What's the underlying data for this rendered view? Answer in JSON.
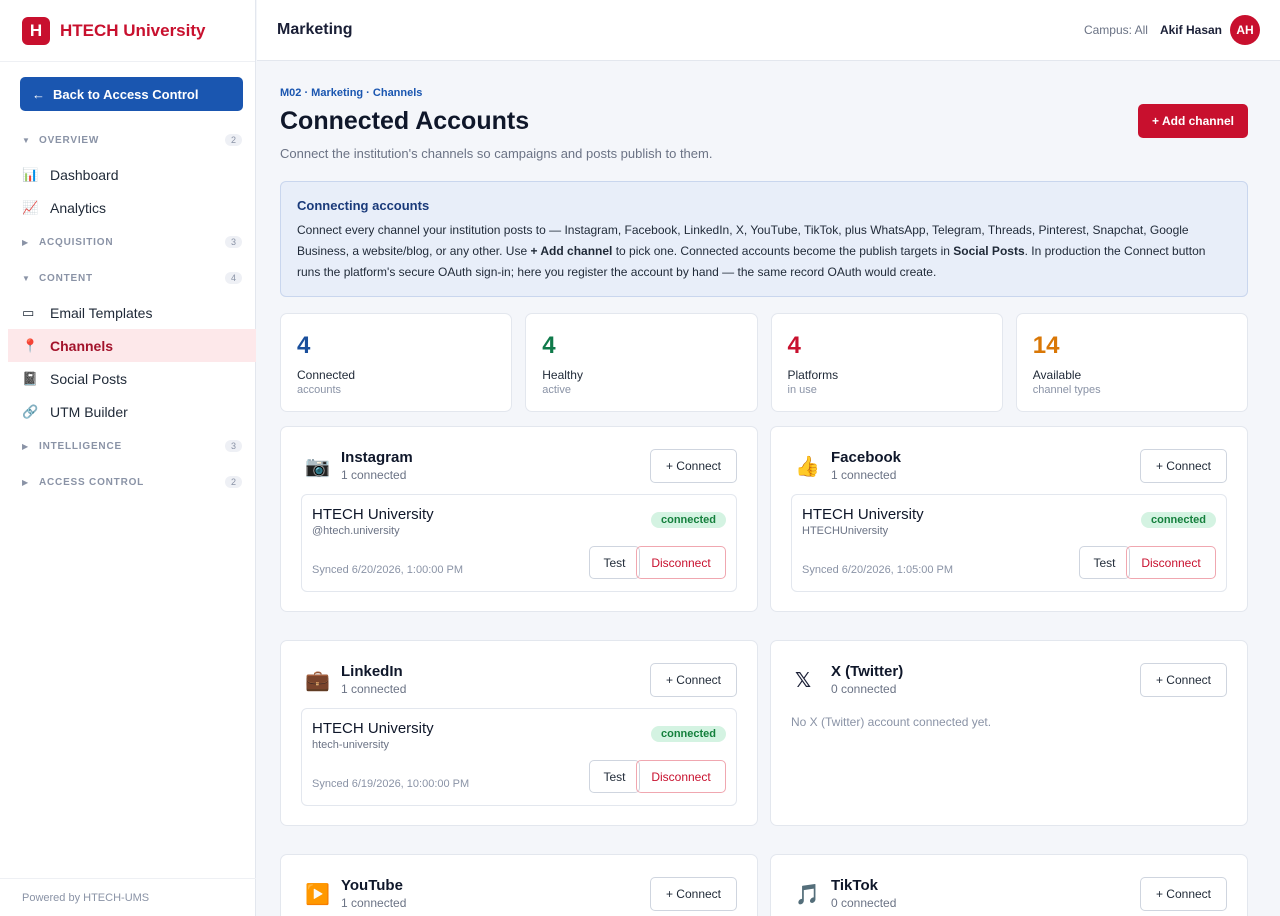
{
  "brand": {
    "logo": "H",
    "name": "HTECH University"
  },
  "back_button": {
    "arrow": "←",
    "label": "Back to Access Control"
  },
  "nav": {
    "overview": {
      "caret": "▼",
      "title": "OVERVIEW",
      "count": "2"
    },
    "dashboard": {
      "icon": "📊",
      "label": "Dashboard"
    },
    "analytics": {
      "icon": "📈",
      "label": "Analytics"
    },
    "acquisition": {
      "caret": "▶",
      "title": "ACQUISITION",
      "count": "3"
    },
    "content": {
      "caret": "▼",
      "title": "CONTENT",
      "count": "4"
    },
    "email_templates": {
      "icon": "▭",
      "label": "Email Templates"
    },
    "channels": {
      "icon": "📍",
      "label": "Channels"
    },
    "social_posts": {
      "icon": "📓",
      "label": "Social Posts"
    },
    "utm_builder": {
      "icon": "🔗",
      "label": "UTM Builder"
    },
    "intelligence": {
      "caret": "▶",
      "title": "INTELLIGENCE",
      "count": "3"
    },
    "access_control": {
      "caret": "▶",
      "title": "ACCESS CONTROL",
      "count": "2"
    }
  },
  "footer": "Powered by HTECH-UMS",
  "topbar": {
    "page": "Marketing",
    "campus": "Campus: All",
    "user": "Akif Hasan",
    "avatar": "AH"
  },
  "header": {
    "breadcrumb": "M02 · Marketing · Channels",
    "title": "Connected Accounts",
    "subtitle": "Connect the institution's channels so campaigns and posts publish to them.",
    "add_button": "+ Add channel"
  },
  "info": {
    "title": "Connecting accounts",
    "p1": "Connect every channel your institution posts to — Instagram, Facebook, LinkedIn, X, YouTube, TikTok, plus WhatsApp, Telegram, Threads, Pinterest, Snapchat, Google Business, a website/blog, or any other. Use ",
    "b1": "+ Add channel",
    "p2": " to pick one. Connected accounts become the publish targets in ",
    "b2": "Social Posts",
    "p3": ". In production the Connect button runs the platform's secure OAuth sign-in; here you register the account by hand — the same record OAuth would create."
  },
  "stats": [
    {
      "value": "4",
      "label": "Connected",
      "sub": "accounts",
      "color": "#1a4f9c"
    },
    {
      "value": "4",
      "label": "Healthy",
      "sub": "active",
      "color": "#0f7a4a"
    },
    {
      "value": "4",
      "label": "Platforms",
      "sub": "in use",
      "color": "#c8102e"
    },
    {
      "value": "14",
      "label": "Available",
      "sub": "channel types",
      "color": "#d97706"
    }
  ],
  "connect_label": "+ Connect",
  "test_label": "Test",
  "disconnect_label": "Disconnect",
  "channels": {
    "instagram": {
      "icon": "📷",
      "name": "Instagram",
      "count": "1 connected",
      "account": "HTECH University",
      "handle": "@htech.university",
      "status": "connected",
      "synced": "Synced 6/20/2026, 1:00:00 PM"
    },
    "facebook": {
      "icon": "👍",
      "name": "Facebook",
      "count": "1 connected",
      "account": "HTECH University",
      "handle": "HTECHUniversity",
      "status": "connected",
      "synced": "Synced 6/20/2026, 1:05:00 PM"
    },
    "linkedin": {
      "icon": "💼",
      "name": "LinkedIn",
      "count": "1 connected",
      "account": "HTECH University",
      "handle": "htech-university",
      "status": "connected",
      "synced": "Synced 6/19/2026, 10:00:00 PM"
    },
    "x": {
      "icon": "𝕏",
      "name": "X (Twitter)",
      "count": "0 connected",
      "empty": "No X (Twitter) account connected yet."
    },
    "youtube": {
      "icon": "▶️",
      "name": "YouTube",
      "count": "1 connected"
    },
    "tiktok": {
      "icon": "🎵",
      "name": "TikTok",
      "count": "0 connected"
    }
  }
}
